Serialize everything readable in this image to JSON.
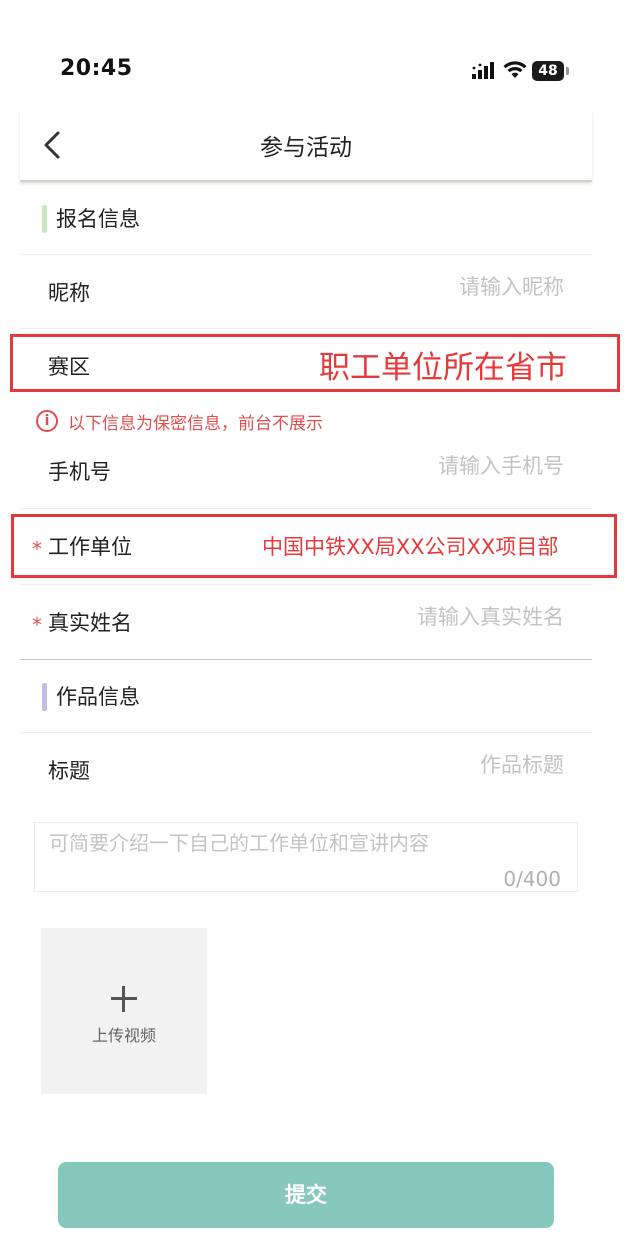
{
  "status_bar": {
    "time": "20:45",
    "battery": "48"
  },
  "nav": {
    "title": "参与活动"
  },
  "section_signup": {
    "title": "报名信息",
    "bar_color": "#c7e8c1"
  },
  "fields": {
    "nickname": {
      "label": "昵称",
      "placeholder": "请输入昵称"
    },
    "region": {
      "label": "赛区"
    },
    "phone": {
      "label": "手机号",
      "placeholder": "请输入手机号"
    },
    "workplace": {
      "label": "工作单位",
      "required_mark": "*"
    },
    "realname": {
      "label": "真实姓名",
      "placeholder": "请输入真实姓名",
      "required_mark": "*"
    }
  },
  "notice": {
    "icon": "i",
    "text": "以下信息为保密信息，前台不展示"
  },
  "annotations": {
    "region_note": "职工单位所在省市",
    "workplace_note": "中国中铁XX局XX公司XX项目部"
  },
  "section_work": {
    "title": "作品信息",
    "bar_color": "#c5bde8"
  },
  "title_field": {
    "label": "标题",
    "placeholder": "作品标题"
  },
  "intro": {
    "placeholder": "可简要介绍一下自己的工作单位和宣讲内容",
    "counter": "0/400"
  },
  "upload": {
    "label": "上传视频"
  },
  "submit": {
    "label": "提交"
  },
  "colors": {
    "accent": "#86c8bb",
    "annotation": "#e6393b",
    "notice": "#e04f4f"
  }
}
